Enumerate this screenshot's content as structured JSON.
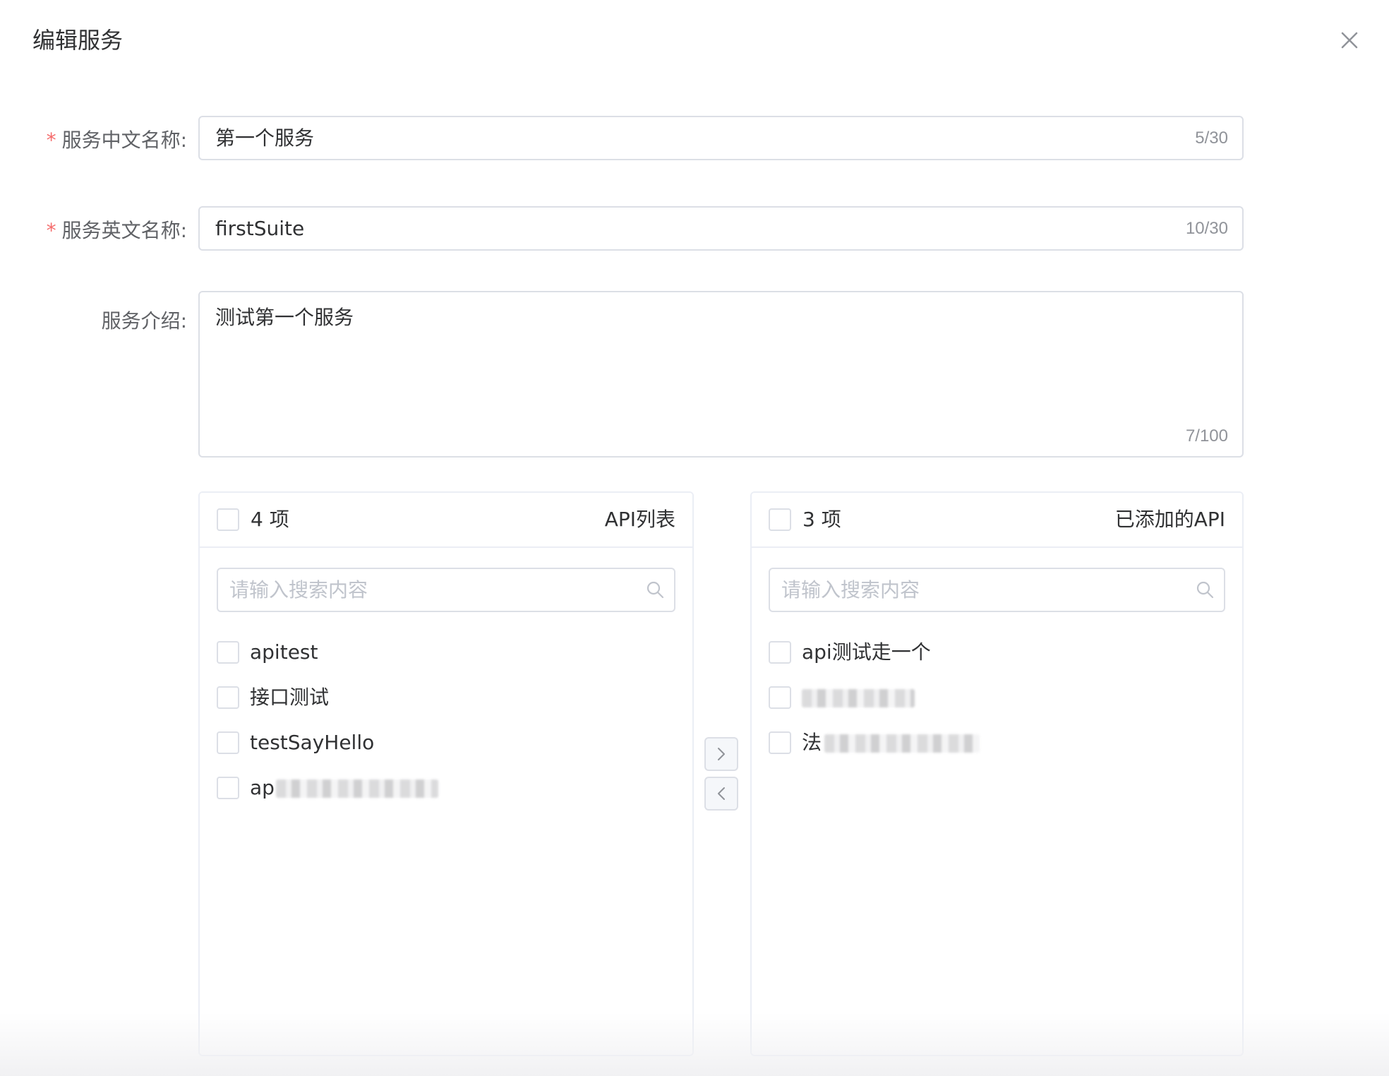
{
  "dialog": {
    "title": "编辑服务",
    "close_icon": "close-icon"
  },
  "form": {
    "cn_name": {
      "required_mark": "*",
      "label": "服务中文名称:",
      "value": "第一个服务",
      "count": "5/30"
    },
    "en_name": {
      "required_mark": "*",
      "label": "服务英文名称:",
      "value": "firstSuite",
      "count": "10/30"
    },
    "description": {
      "label": "服务介绍:",
      "value": "测试第一个服务",
      "count": "7/100"
    }
  },
  "transfer": {
    "left": {
      "count_text": "4 项",
      "title": "API列表",
      "search_placeholder": "请输入搜索内容",
      "items": [
        {
          "label": "apitest"
        },
        {
          "label": "接口测试"
        },
        {
          "label": "testSayHello"
        },
        {
          "label": "ap",
          "redacted": true
        }
      ]
    },
    "right": {
      "count_text": "3 项",
      "title": "已添加的API",
      "search_placeholder": "请输入搜索内容",
      "items": [
        {
          "label": "api测试走一个"
        },
        {
          "label": "",
          "redacted": true
        },
        {
          "label": "法",
          "redacted": true
        }
      ]
    },
    "buttons": {
      "to_right_icon": "chevron-right-icon",
      "to_left_icon": "chevron-left-icon"
    }
  },
  "colors": {
    "required": "#f56c6c",
    "border": "#dcdfe6",
    "placeholder": "#c0c4cc",
    "count": "#909399"
  }
}
